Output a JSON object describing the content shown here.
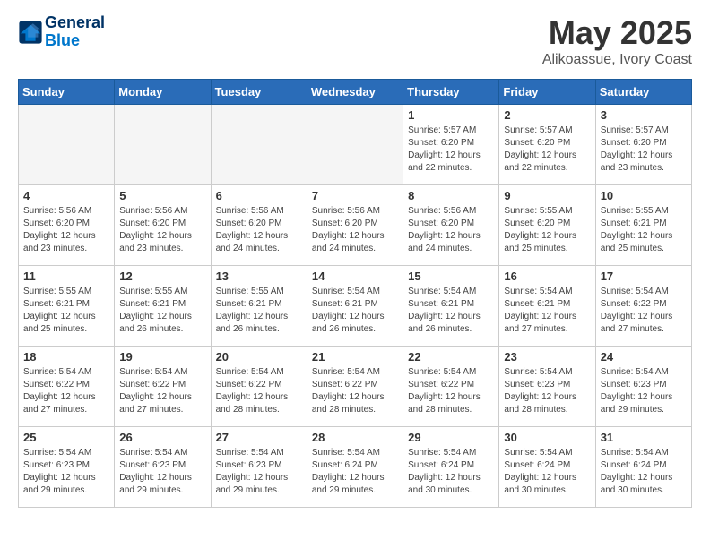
{
  "header": {
    "logo_line1": "General",
    "logo_line2": "Blue",
    "title": "May 2025",
    "subtitle": "Alikoassue, Ivory Coast"
  },
  "days_of_week": [
    "Sunday",
    "Monday",
    "Tuesday",
    "Wednesday",
    "Thursday",
    "Friday",
    "Saturday"
  ],
  "weeks": [
    [
      {
        "day": "",
        "detail": "",
        "empty": true
      },
      {
        "day": "",
        "detail": "",
        "empty": true
      },
      {
        "day": "",
        "detail": "",
        "empty": true
      },
      {
        "day": "",
        "detail": "",
        "empty": true
      },
      {
        "day": "1",
        "detail": "Sunrise: 5:57 AM\nSunset: 6:20 PM\nDaylight: 12 hours\nand 22 minutes."
      },
      {
        "day": "2",
        "detail": "Sunrise: 5:57 AM\nSunset: 6:20 PM\nDaylight: 12 hours\nand 22 minutes."
      },
      {
        "day": "3",
        "detail": "Sunrise: 5:57 AM\nSunset: 6:20 PM\nDaylight: 12 hours\nand 23 minutes."
      }
    ],
    [
      {
        "day": "4",
        "detail": "Sunrise: 5:56 AM\nSunset: 6:20 PM\nDaylight: 12 hours\nand 23 minutes."
      },
      {
        "day": "5",
        "detail": "Sunrise: 5:56 AM\nSunset: 6:20 PM\nDaylight: 12 hours\nand 23 minutes."
      },
      {
        "day": "6",
        "detail": "Sunrise: 5:56 AM\nSunset: 6:20 PM\nDaylight: 12 hours\nand 24 minutes."
      },
      {
        "day": "7",
        "detail": "Sunrise: 5:56 AM\nSunset: 6:20 PM\nDaylight: 12 hours\nand 24 minutes."
      },
      {
        "day": "8",
        "detail": "Sunrise: 5:56 AM\nSunset: 6:20 PM\nDaylight: 12 hours\nand 24 minutes."
      },
      {
        "day": "9",
        "detail": "Sunrise: 5:55 AM\nSunset: 6:20 PM\nDaylight: 12 hours\nand 25 minutes."
      },
      {
        "day": "10",
        "detail": "Sunrise: 5:55 AM\nSunset: 6:21 PM\nDaylight: 12 hours\nand 25 minutes."
      }
    ],
    [
      {
        "day": "11",
        "detail": "Sunrise: 5:55 AM\nSunset: 6:21 PM\nDaylight: 12 hours\nand 25 minutes."
      },
      {
        "day": "12",
        "detail": "Sunrise: 5:55 AM\nSunset: 6:21 PM\nDaylight: 12 hours\nand 26 minutes."
      },
      {
        "day": "13",
        "detail": "Sunrise: 5:55 AM\nSunset: 6:21 PM\nDaylight: 12 hours\nand 26 minutes."
      },
      {
        "day": "14",
        "detail": "Sunrise: 5:54 AM\nSunset: 6:21 PM\nDaylight: 12 hours\nand 26 minutes."
      },
      {
        "day": "15",
        "detail": "Sunrise: 5:54 AM\nSunset: 6:21 PM\nDaylight: 12 hours\nand 26 minutes."
      },
      {
        "day": "16",
        "detail": "Sunrise: 5:54 AM\nSunset: 6:21 PM\nDaylight: 12 hours\nand 27 minutes."
      },
      {
        "day": "17",
        "detail": "Sunrise: 5:54 AM\nSunset: 6:22 PM\nDaylight: 12 hours\nand 27 minutes."
      }
    ],
    [
      {
        "day": "18",
        "detail": "Sunrise: 5:54 AM\nSunset: 6:22 PM\nDaylight: 12 hours\nand 27 minutes."
      },
      {
        "day": "19",
        "detail": "Sunrise: 5:54 AM\nSunset: 6:22 PM\nDaylight: 12 hours\nand 27 minutes."
      },
      {
        "day": "20",
        "detail": "Sunrise: 5:54 AM\nSunset: 6:22 PM\nDaylight: 12 hours\nand 28 minutes."
      },
      {
        "day": "21",
        "detail": "Sunrise: 5:54 AM\nSunset: 6:22 PM\nDaylight: 12 hours\nand 28 minutes."
      },
      {
        "day": "22",
        "detail": "Sunrise: 5:54 AM\nSunset: 6:22 PM\nDaylight: 12 hours\nand 28 minutes."
      },
      {
        "day": "23",
        "detail": "Sunrise: 5:54 AM\nSunset: 6:23 PM\nDaylight: 12 hours\nand 28 minutes."
      },
      {
        "day": "24",
        "detail": "Sunrise: 5:54 AM\nSunset: 6:23 PM\nDaylight: 12 hours\nand 29 minutes."
      }
    ],
    [
      {
        "day": "25",
        "detail": "Sunrise: 5:54 AM\nSunset: 6:23 PM\nDaylight: 12 hours\nand 29 minutes."
      },
      {
        "day": "26",
        "detail": "Sunrise: 5:54 AM\nSunset: 6:23 PM\nDaylight: 12 hours\nand 29 minutes."
      },
      {
        "day": "27",
        "detail": "Sunrise: 5:54 AM\nSunset: 6:23 PM\nDaylight: 12 hours\nand 29 minutes."
      },
      {
        "day": "28",
        "detail": "Sunrise: 5:54 AM\nSunset: 6:24 PM\nDaylight: 12 hours\nand 29 minutes."
      },
      {
        "day": "29",
        "detail": "Sunrise: 5:54 AM\nSunset: 6:24 PM\nDaylight: 12 hours\nand 30 minutes."
      },
      {
        "day": "30",
        "detail": "Sunrise: 5:54 AM\nSunset: 6:24 PM\nDaylight: 12 hours\nand 30 minutes."
      },
      {
        "day": "31",
        "detail": "Sunrise: 5:54 AM\nSunset: 6:24 PM\nDaylight: 12 hours\nand 30 minutes."
      }
    ]
  ]
}
